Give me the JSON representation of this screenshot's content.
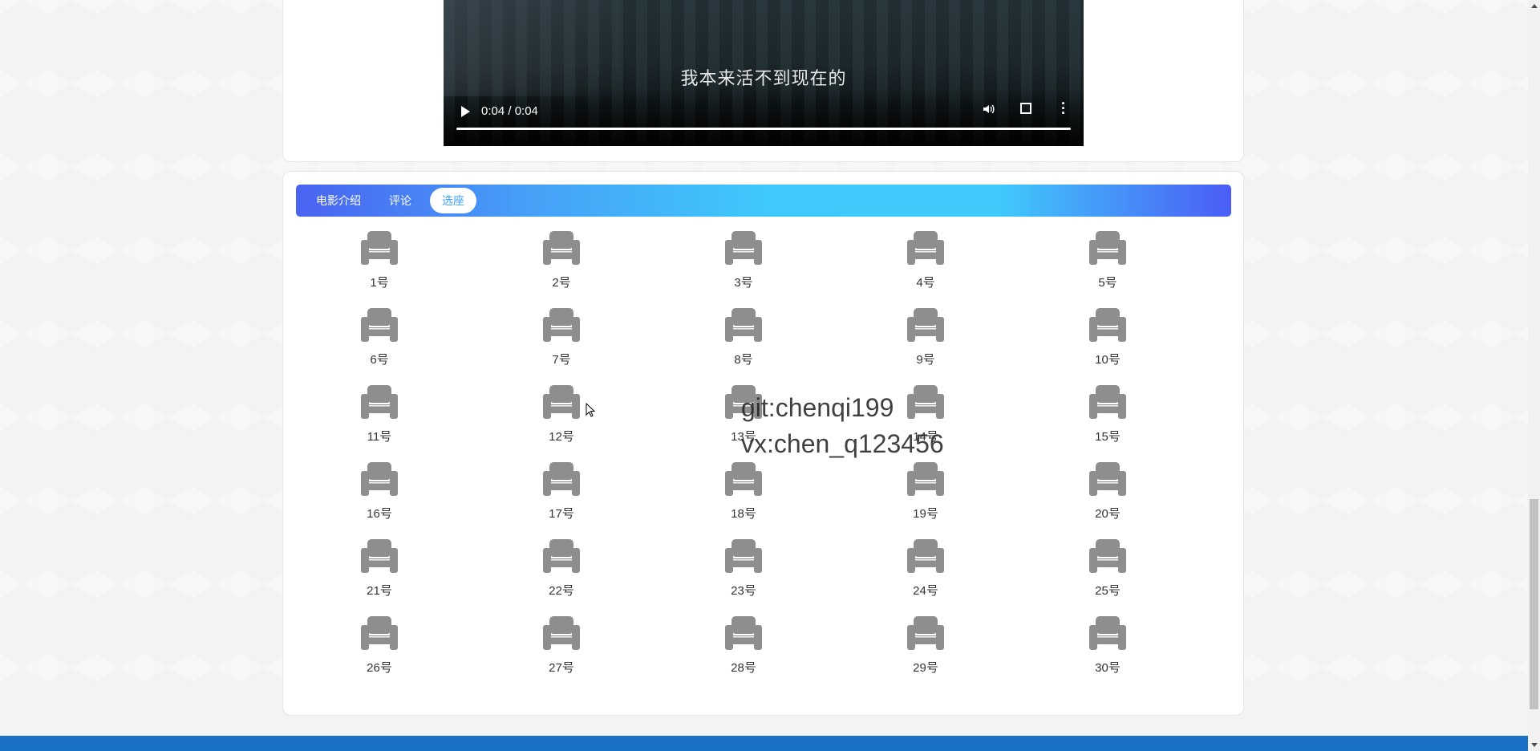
{
  "video": {
    "subtitle": "我本来活不到现在的",
    "time": "0:04 / 0:04",
    "play_icon": "play-icon",
    "volume_icon": "volume-icon",
    "fullscreen_icon": "fullscreen-icon",
    "more_icon": "more-vert-icon",
    "progress": 1.0
  },
  "tabs": [
    {
      "label": "电影介绍",
      "active": false
    },
    {
      "label": "评论",
      "active": false
    },
    {
      "label": "选座",
      "active": true
    }
  ],
  "seats": [
    "1号",
    "2号",
    "3号",
    "4号",
    "5号",
    "6号",
    "7号",
    "8号",
    "9号",
    "10号",
    "11号",
    "12号",
    "13号",
    "14号",
    "15号",
    "16号",
    "17号",
    "18号",
    "19号",
    "20号",
    "21号",
    "22号",
    "23号",
    "24号",
    "25号",
    "26号",
    "27号",
    "28号",
    "29号",
    "30号"
  ],
  "watermark": {
    "line1": "git:chenqi199",
    "line2": "vx:chen_q123456"
  },
  "colors": {
    "tab_gradient_start": "#4a63f2",
    "tab_gradient_mid": "#3fc8fb",
    "seat_color": "#8e8e8e",
    "active_tab_text": "#3aa1f6",
    "footer": "#1a6fc7"
  }
}
